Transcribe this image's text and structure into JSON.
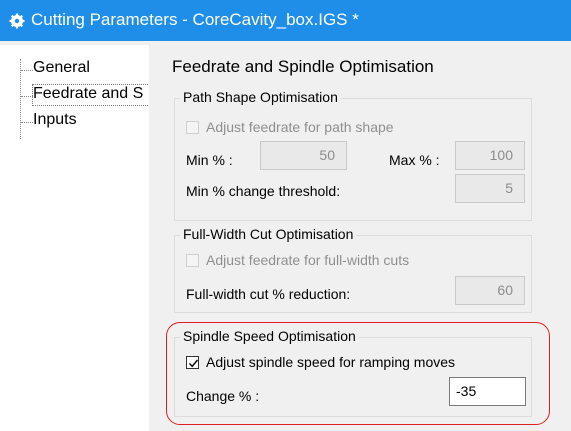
{
  "window": {
    "title": "Cutting Parameters - CoreCavity_box.IGS *",
    "title_icon": "gear-icon"
  },
  "tree": {
    "items": [
      {
        "label": "General"
      },
      {
        "label": "Feedrate and S"
      },
      {
        "label": "Inputs"
      }
    ],
    "selected_index": 1
  },
  "panel": {
    "title": "Feedrate and Spindle Optimisation",
    "path_shape": {
      "group_title": "Path Shape Optimisation",
      "checkbox_label": "Adjust feedrate for path shape",
      "checked": false,
      "enabled": false,
      "min_label": "Min % :",
      "min_value": "50",
      "max_label": "Max % :",
      "max_value": "100",
      "threshold_label": "Min % change threshold:",
      "threshold_value": "5"
    },
    "full_width": {
      "group_title": "Full-Width Cut Optimisation",
      "checkbox_label": "Adjust feedrate for full-width cuts",
      "checked": false,
      "enabled": false,
      "reduction_label": "Full-width cut % reduction:",
      "reduction_value": "60"
    },
    "spindle": {
      "group_title": "Spindle Speed Optimisation",
      "checkbox_label": "Adjust spindle speed for ramping moves",
      "checked": true,
      "enabled": true,
      "change_label": "Change % :",
      "change_value": "-35"
    }
  },
  "colors": {
    "titlebar": "#1f8ee8",
    "highlight": "#e02020",
    "panel_bg": "#f0f0f0"
  }
}
